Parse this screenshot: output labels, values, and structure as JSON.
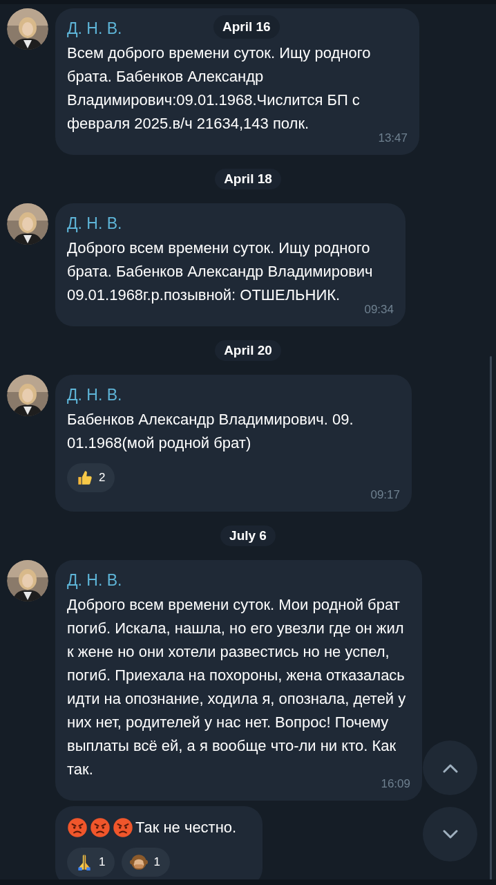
{
  "days": [
    {
      "date": "April 16",
      "messages": [
        {
          "sender": "Д. Н. В.",
          "text": "Всем доброго времени суток. Ищу родного брата. Бабенков Александр Владимирович:09.01.1968.Числится БП с февраля 2025.в/ч 21634,143 полк.",
          "time": "13:47"
        }
      ]
    },
    {
      "date": "April 18",
      "messages": [
        {
          "sender": "Д. Н. В.",
          "text": "Доброго всем времени суток. Ищу родного брата. Бабенков Александр Владимирович 09.01.1968г.р.позывной: ОТШЕЛЬНИК.",
          "time": "09:34"
        }
      ]
    },
    {
      "date": "April 20",
      "messages": [
        {
          "sender": "Д. Н. В.",
          "text": "Бабенков Александр Владимирович. 09. 01.1968(мой родной брат)",
          "time": "09:17",
          "reactions": [
            {
              "kind": "thumbs-up",
              "count": "2"
            }
          ]
        }
      ]
    },
    {
      "date": "July 6",
      "messages": [
        {
          "sender": "Д. Н. В.",
          "text": "Доброго всем времени суток. Мои родной брат погиб. Искала, нашла, но его увезли где он жил к жене но они хотели развестись но не успел, погиб. Приехала на похороны, жена отказалась идти на опознание, ходила я, опознала, детей у них нет, родителей у нас нет. Вопрос! Почему выплаты всё ей, а я вообще что-ли ни кто. Как так.",
          "time": "16:09"
        },
        {
          "leading_emoji": [
            {
              "kind": "angry"
            },
            {
              "kind": "angry"
            },
            {
              "kind": "angry"
            }
          ],
          "text": "Так не честно.",
          "reactions": [
            {
              "kind": "praying-hands",
              "count": "1"
            },
            {
              "kind": "monkey",
              "count": "1"
            }
          ]
        }
      ]
    }
  ]
}
